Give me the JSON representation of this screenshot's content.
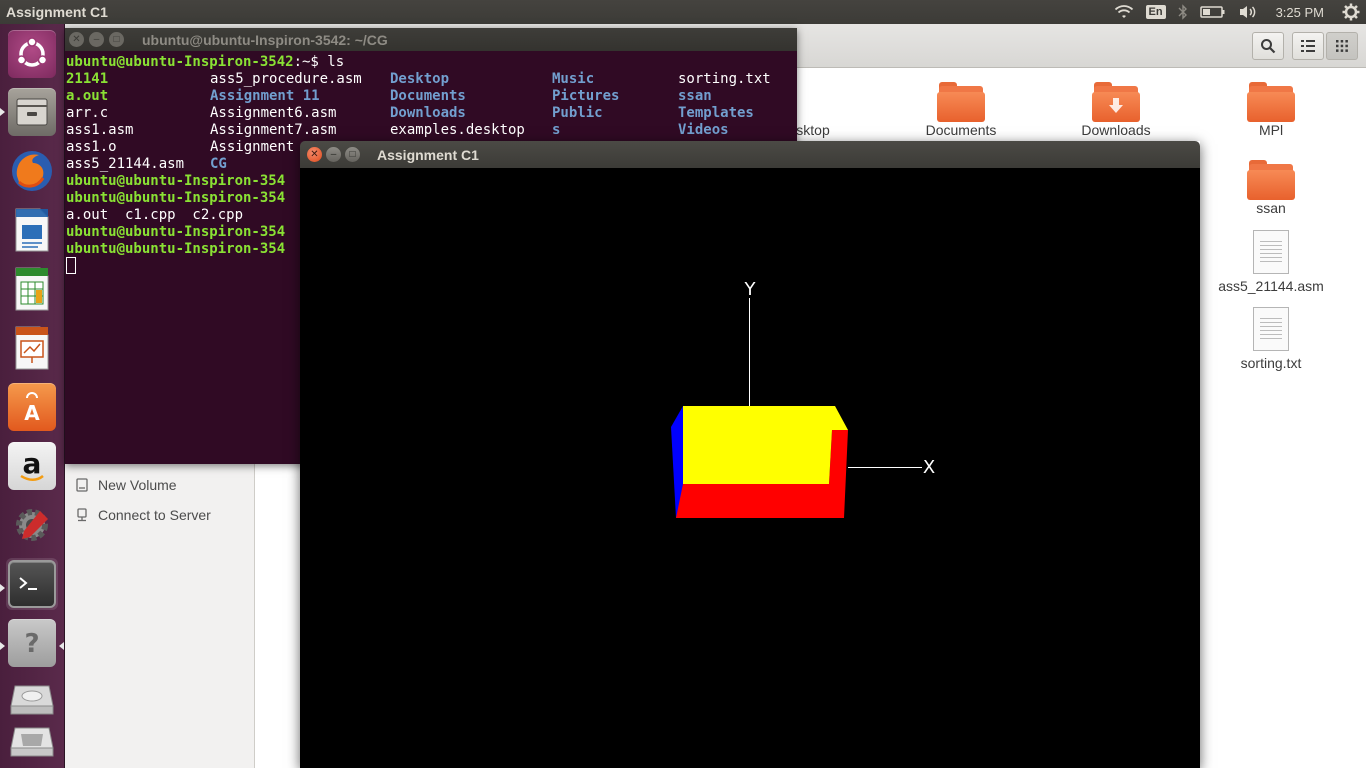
{
  "top_panel": {
    "title": "Assignment C1",
    "keyboard": "En",
    "time": "3:25 PM"
  },
  "launcher": {
    "items": [
      "ubuntu-dash-icon",
      "files-icon",
      "firefox-icon",
      "libreoffice-writer-icon",
      "libreoffice-calc-icon",
      "libreoffice-impress-icon",
      "ubuntu-software-icon",
      "amazon-icon",
      "system-settings-icon",
      "terminal-icon",
      "help-icon",
      "drive-icon",
      "trash-icon"
    ]
  },
  "files": {
    "sidebar": {
      "new_volume": "New Volume",
      "connect_server": "Connect to Server"
    },
    "items": {
      "desktop": "sktop",
      "documents": "Documents",
      "downloads": "Downloads",
      "mpl": "MPl",
      "ssan": "ssan",
      "ass5": "ass5_21144.asm",
      "sorting": "sorting.txt"
    }
  },
  "terminal": {
    "title": "ubuntu@ubuntu-Inspiron-3542: ~/CG",
    "prompt_full": "ubuntu@ubuntu-Inspiron-3542",
    "prompt_tail": ":~$ ls",
    "prompt_trunc": "ubuntu@ubuntu-Inspiron-354",
    "ls_col1": [
      "21141",
      "a.out",
      "arr.c",
      "ass1.asm",
      "ass1.o",
      "ass5_21144.asm"
    ],
    "ls_col2": [
      "ass5_procedure.asm",
      "Assignment 11",
      "Assignment6.asm",
      "Assignment7.asm",
      "Assignment",
      "CG"
    ],
    "ls_col3": [
      "Desktop",
      "Documents",
      "Downloads",
      "examples.desktop",
      "",
      ""
    ],
    "ls_col4": [
      "Music",
      "Pictures",
      "Public",
      "s",
      "",
      ""
    ],
    "ls_col5": [
      "sorting.txt",
      "ssan",
      "Templates",
      "Videos",
      "",
      ""
    ],
    "ls_cg": "a.out  c1.cpp  c2.cpp"
  },
  "gl_window": {
    "title": "Assignment C1",
    "axis_x": "X",
    "axis_y": "Y"
  }
}
